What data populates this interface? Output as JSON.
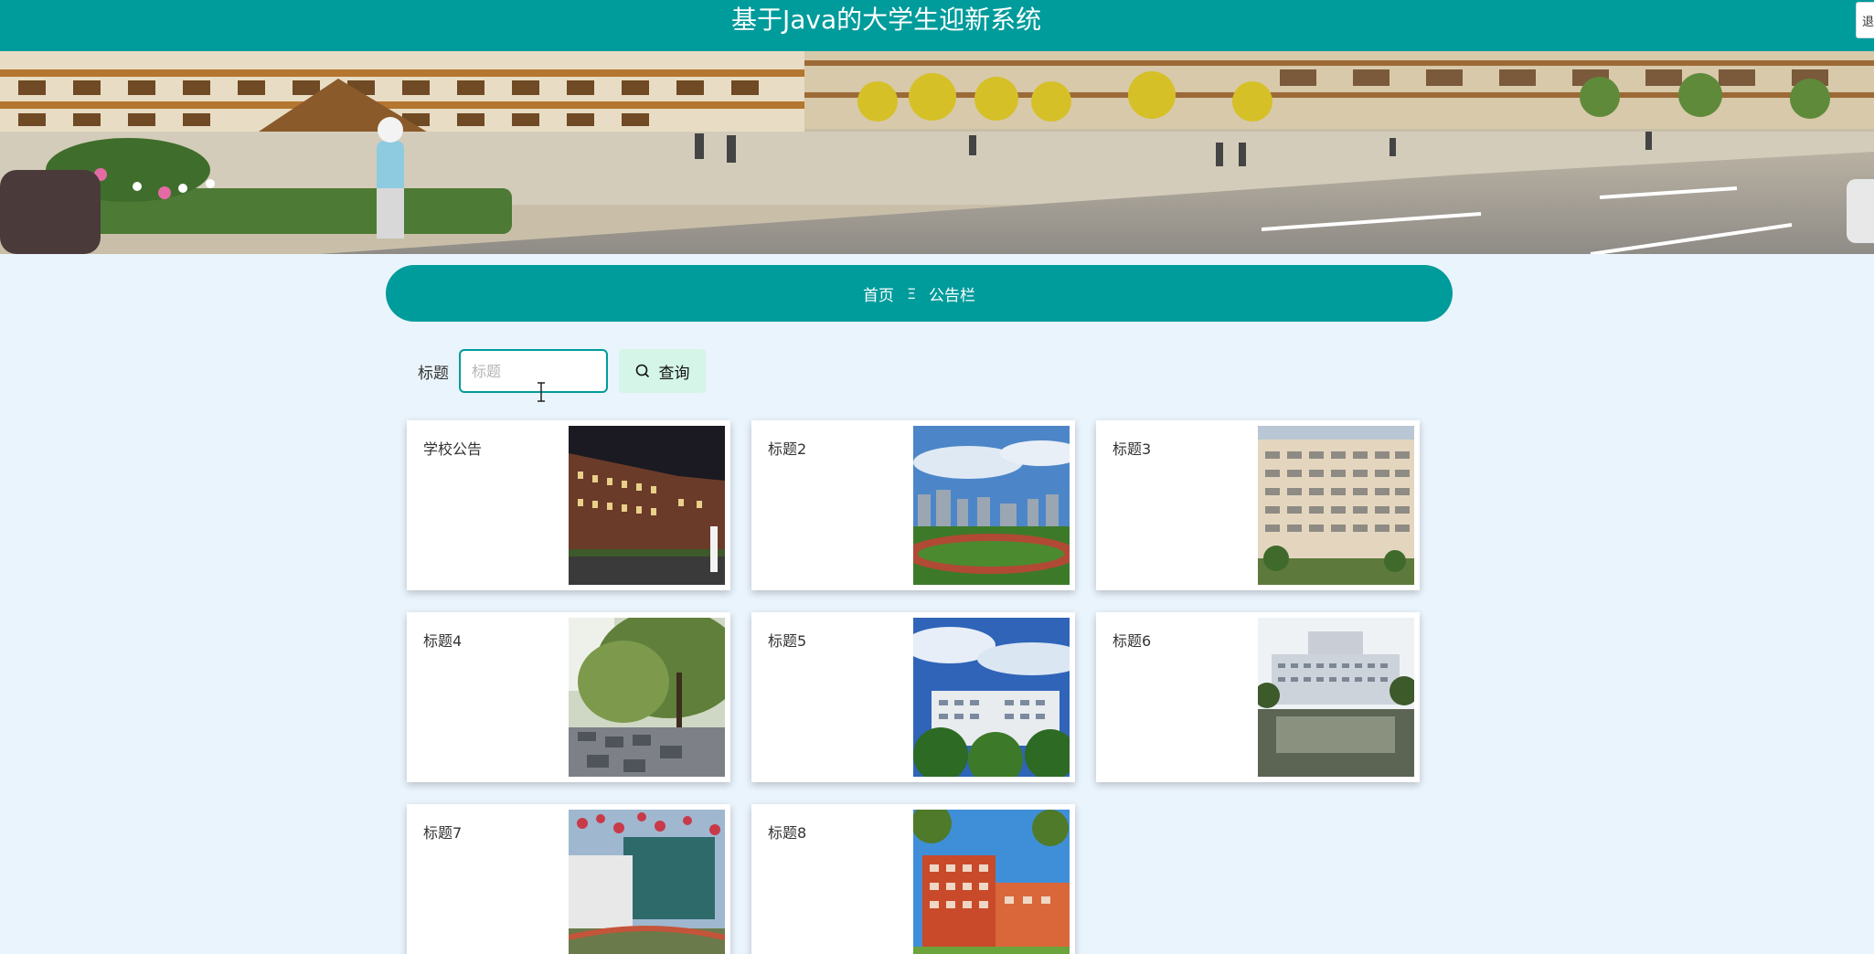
{
  "header": {
    "title": "基于Java的大学生迎新系统",
    "corner_button_label": "退"
  },
  "banner": {
    "slide_count": 3,
    "active_slide": 1
  },
  "breadcrumb": {
    "home": "首页",
    "separator": "Ξ",
    "current": "公告栏"
  },
  "search": {
    "label": "标题",
    "placeholder": "标题",
    "value": "",
    "button_label": "查询"
  },
  "notices": [
    {
      "title": "学校公告",
      "image": "night-campus-building"
    },
    {
      "title": "标题2",
      "image": "sports-field-city"
    },
    {
      "title": "标题3",
      "image": "tall-dormitory-building"
    },
    {
      "title": "标题4",
      "image": "willow-tree-plaza"
    },
    {
      "title": "标题5",
      "image": "campus-building-blue-sky"
    },
    {
      "title": "标题6",
      "image": "building-reflection-pool"
    },
    {
      "title": "标题7",
      "image": "library-blossom-tree"
    },
    {
      "title": "标题8",
      "image": "red-brick-building"
    }
  ],
  "colors": {
    "primary": "#009b9b",
    "page_background": "#eaf4fc",
    "search_button": "#d4f5e8"
  }
}
